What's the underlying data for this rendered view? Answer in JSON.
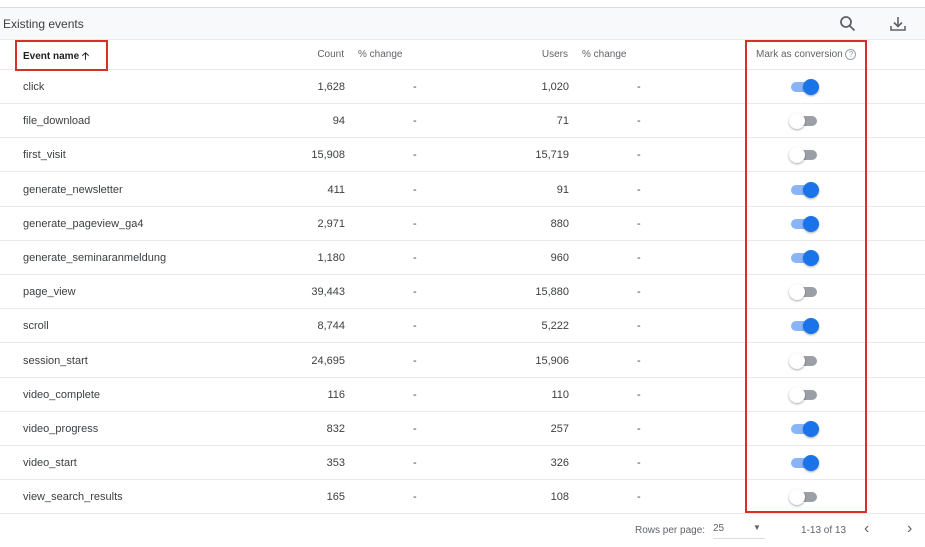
{
  "title": "Existing events",
  "icons": {
    "search": "search-icon",
    "download": "download-icon"
  },
  "columns": {
    "event_name": "Event name",
    "count": "Count",
    "count_change": "% change",
    "users": "Users",
    "users_change": "% change",
    "conversion": "Mark as conversion"
  },
  "rows": [
    {
      "name": "click",
      "count": "1,628",
      "count_change": "-",
      "users": "1,020",
      "users_change": "-",
      "conversion": true
    },
    {
      "name": "file_download",
      "count": "94",
      "count_change": "-",
      "users": "71",
      "users_change": "-",
      "conversion": false
    },
    {
      "name": "first_visit",
      "count": "15,908",
      "count_change": "-",
      "users": "15,719",
      "users_change": "-",
      "conversion": false
    },
    {
      "name": "generate_newsletter",
      "count": "411",
      "count_change": "-",
      "users": "91",
      "users_change": "-",
      "conversion": true
    },
    {
      "name": "generate_pageview_ga4",
      "count": "2,971",
      "count_change": "-",
      "users": "880",
      "users_change": "-",
      "conversion": true
    },
    {
      "name": "generate_seminaranmeldung",
      "count": "1,180",
      "count_change": "-",
      "users": "960",
      "users_change": "-",
      "conversion": true
    },
    {
      "name": "page_view",
      "count": "39,443",
      "count_change": "-",
      "users": "15,880",
      "users_change": "-",
      "conversion": false
    },
    {
      "name": "scroll",
      "count": "8,744",
      "count_change": "-",
      "users": "5,222",
      "users_change": "-",
      "conversion": true
    },
    {
      "name": "session_start",
      "count": "24,695",
      "count_change": "-",
      "users": "15,906",
      "users_change": "-",
      "conversion": false
    },
    {
      "name": "video_complete",
      "count": "116",
      "count_change": "-",
      "users": "110",
      "users_change": "-",
      "conversion": false
    },
    {
      "name": "video_progress",
      "count": "832",
      "count_change": "-",
      "users": "257",
      "users_change": "-",
      "conversion": true
    },
    {
      "name": "video_start",
      "count": "353",
      "count_change": "-",
      "users": "326",
      "users_change": "-",
      "conversion": true
    },
    {
      "name": "view_search_results",
      "count": "165",
      "count_change": "-",
      "users": "108",
      "users_change": "-",
      "conversion": false
    }
  ],
  "footer": {
    "rows_per_page_label": "Rows per page:",
    "rows_per_page": "25",
    "range": "1-13 of 13"
  },
  "colors": {
    "accent": "#1a73e8",
    "highlight": "#d93025"
  }
}
